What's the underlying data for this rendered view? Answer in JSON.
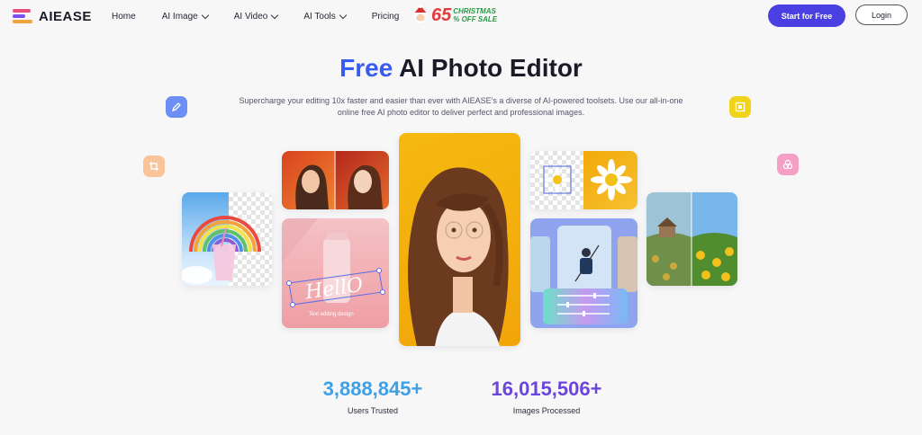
{
  "brand": {
    "name": "AIEASE"
  },
  "nav": {
    "items": [
      {
        "label": "Home",
        "dropdown": false
      },
      {
        "label": "AI Image",
        "dropdown": true
      },
      {
        "label": "AI Video",
        "dropdown": true
      },
      {
        "label": "AI Tools",
        "dropdown": true
      },
      {
        "label": "Pricing",
        "dropdown": false
      }
    ]
  },
  "promo": {
    "percent": "65",
    "line1": "CHRISTMAS",
    "line2": "% OFF SALE"
  },
  "actions": {
    "start_label": "Start for Free",
    "login_label": "Login"
  },
  "hero": {
    "title_accent": "Free",
    "title_rest": "AI Photo Editor",
    "subtitle": "Supercharge your editing 10x faster and easier than ever with AIEASE's a diverse of AI-powered toolsets. Use our all-in-one online free AI photo editor to deliver perfect and professional images."
  },
  "cards": {
    "text_edit_script": "HellO",
    "text_edit_caption": "Text editing design"
  },
  "stats": [
    {
      "value": "3,888,845+",
      "label": "Users Trusted",
      "color": "#3ea0e6"
    },
    {
      "value": "16,015,506+",
      "label": "Images Processed",
      "color": "#6a46dc"
    }
  ],
  "colors": {
    "accent": "#3a5bf0",
    "button": "#4a3fe0",
    "promo_red": "#e23b3b",
    "promo_green": "#2a9a45"
  },
  "icons": [
    "pen-icon",
    "crop-icon",
    "frame-icon",
    "layers-icon"
  ]
}
